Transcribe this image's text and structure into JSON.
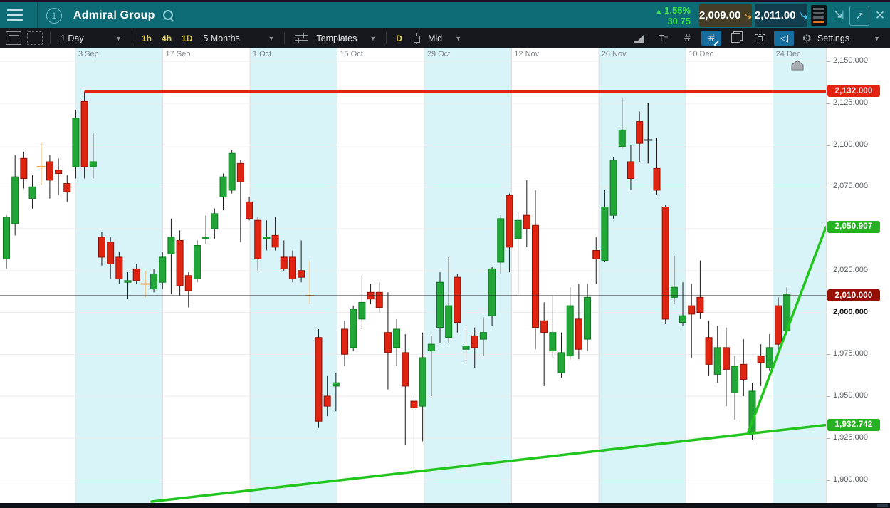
{
  "header": {
    "title": "Admiral Group",
    "change_percent": "1.55%",
    "change_up_symbol": "▲",
    "change_value": "30.75",
    "sell_price": "2,009.00",
    "buy_price": "2,011.00"
  },
  "toolbar": {
    "period_dropdown": "1 Day",
    "interval_buttons": [
      "1h",
      "4h",
      "1D"
    ],
    "range_dropdown": "5 Months",
    "templates_label": "Templates",
    "candle_period_button": "D",
    "price_type_dropdown": "Mid",
    "settings_label": "Settings"
  },
  "chart_data": {
    "type": "candlestick",
    "instrument": "Admiral Group",
    "interval": "1 Day",
    "range": "5 Months",
    "x_labels": [
      "3 Sep",
      "17 Sep",
      "1 Oct",
      "15 Oct",
      "29 Oct",
      "12 Nov",
      "26 Nov",
      "10 Dec",
      "24 Dec"
    ],
    "y_axis": {
      "min": 1900,
      "max": 2150,
      "grid_step": 25,
      "ticks": [
        {
          "label": "2,150.000",
          "price": 2150
        },
        {
          "label": "2,125.000",
          "price": 2125
        },
        {
          "label": "2,100.000",
          "price": 2100
        },
        {
          "label": "2,075.000",
          "price": 2075
        },
        {
          "label": "2,025.000",
          "price": 2025
        },
        {
          "label": "2,000.000",
          "price": 2000,
          "bold": true
        },
        {
          "label": "1,975.000",
          "price": 1975
        },
        {
          "label": "1,950.000",
          "price": 1950
        },
        {
          "label": "1,925.000",
          "price": 1925
        },
        {
          "label": "1,900.000",
          "price": 1900
        }
      ]
    },
    "price_tags": [
      {
        "label": "2,132.000",
        "price": 2132,
        "bg": "#e3230f",
        "role": "resistance-line-price"
      },
      {
        "label": "2,050.907",
        "price": 2050.907,
        "bg": "#25b220",
        "role": "rising-trendline-target"
      },
      {
        "label": "2,010.000",
        "price": 2010,
        "bg": "#970e02",
        "role": "current-price"
      },
      {
        "label": "1,932.742",
        "price": 1932.742,
        "bg": "#25b220",
        "role": "support-trendline-level"
      }
    ],
    "overlays": {
      "resistance_line": {
        "price": 2132,
        "color": "#e3230f"
      },
      "current_price_line": {
        "price": 2010,
        "color": "#222222"
      },
      "support_trendline": {
        "end_price": 1932.742,
        "color": "#22c51d"
      },
      "rising_trendline": {
        "end_price": 2050.907,
        "color": "#22c51d"
      }
    },
    "colors": {
      "up": "#21a637",
      "down": "#e02412",
      "doji_orange": "#f0a33c",
      "doji_dark": "#26282b",
      "band": "#d8f4f9"
    },
    "candles": [
      [
        2032,
        2058,
        2026,
        2057
      ],
      [
        2053,
        2094,
        2046,
        2081
      ],
      [
        2092,
        2096,
        2074,
        2080
      ],
      [
        2068,
        2082,
        2062,
        2075
      ],
      [
        2087,
        2101,
        2076,
        2087,
        "od"
      ],
      [
        2090,
        2094,
        2068,
        2079
      ],
      [
        2085,
        2092,
        2070,
        2083
      ],
      [
        2077,
        2082,
        2066,
        2072
      ],
      [
        2087,
        2121,
        2080,
        2116
      ],
      [
        2126,
        2132,
        2080,
        2087
      ],
      [
        2087,
        2107,
        2080,
        2090
      ],
      [
        2045,
        2048,
        2028,
        2033
      ],
      [
        2042,
        2045,
        2020,
        2029
      ],
      [
        2033,
        2036,
        2017,
        2020
      ],
      [
        2018,
        2024,
        2008,
        2019
      ],
      [
        2026,
        2029,
        2017,
        2019
      ],
      [
        2017,
        2025,
        2009,
        2017,
        "od"
      ],
      [
        2014,
        2026,
        2012,
        2023
      ],
      [
        2018,
        2036,
        2014,
        2033
      ],
      [
        2035,
        2056,
        2011,
        2045
      ],
      [
        2043,
        2049,
        2010,
        2016
      ],
      [
        2022,
        2024,
        2003,
        2013
      ],
      [
        2020,
        2043,
        2018,
        2040
      ],
      [
        2044,
        2058,
        2041,
        2045
      ],
      [
        2050,
        2062,
        2044,
        2059
      ],
      [
        2069,
        2083,
        2061,
        2081
      ],
      [
        2073,
        2097,
        2071,
        2095
      ],
      [
        2089,
        2091,
        2042,
        2078
      ],
      [
        2066,
        2069,
        2055,
        2056
      ],
      [
        2055,
        2057,
        2025,
        2032
      ],
      [
        2044,
        2055,
        2037,
        2045
      ],
      [
        2046,
        2057,
        2037,
        2039
      ],
      [
        2033,
        2043,
        2025,
        2026
      ],
      [
        2033,
        2037,
        2018,
        2020
      ],
      [
        2025,
        2043,
        2018,
        2021
      ],
      [
        2010,
        2031,
        2005,
        2010,
        "od"
      ],
      [
        1985,
        1990,
        1931,
        1935
      ],
      [
        1950,
        1962,
        1938,
        1944
      ],
      [
        1956,
        1964,
        1941,
        1958
      ],
      [
        1990,
        1995,
        1968,
        1975
      ],
      [
        1979,
        2004,
        1977,
        2002
      ],
      [
        1996,
        2022,
        1990,
        2006
      ],
      [
        2012,
        2017,
        2005,
        2008
      ],
      [
        2012,
        2018,
        2000,
        2003
      ],
      [
        1988,
        2012,
        1954,
        1976
      ],
      [
        1979,
        1996,
        1968,
        1990
      ],
      [
        1976,
        1987,
        1921,
        1956
      ],
      [
        1947,
        1951,
        1902,
        1943
      ],
      [
        1944,
        1988,
        1923,
        1973
      ],
      [
        1977,
        1986,
        1950,
        1981
      ],
      [
        1991,
        2024,
        1982,
        2018
      ],
      [
        1985,
        2033,
        1982,
        2004
      ],
      [
        2021,
        2023,
        1988,
        1994
      ],
      [
        1978,
        1992,
        1970,
        1980
      ],
      [
        1986,
        1991,
        1967,
        1979
      ],
      [
        1984,
        1997,
        1974,
        1988
      ],
      [
        1998,
        2027,
        1992,
        2026
      ],
      [
        2030,
        2058,
        2023,
        2056
      ],
      [
        2070,
        2071,
        2024,
        2039
      ],
      [
        2044,
        2060,
        2011,
        2055
      ],
      [
        2058,
        2079,
        2039,
        2050
      ],
      [
        2052,
        2073,
        1978,
        1991
      ],
      [
        1995,
        2006,
        1956,
        1988
      ],
      [
        1977,
        2010,
        1973,
        1988
      ],
      [
        1964,
        1988,
        1961,
        1976
      ],
      [
        1974,
        2015,
        1972,
        2004
      ],
      [
        1996,
        2017,
        1972,
        1978
      ],
      [
        1984,
        2017,
        1977,
        2009
      ],
      [
        2037,
        2045,
        2017,
        2032
      ],
      [
        2031,
        2073,
        2030,
        2063
      ],
      [
        2058,
        2093,
        2056,
        2091
      ],
      [
        2099,
        2128,
        2098,
        2109
      ],
      [
        2090,
        2100,
        2073,
        2080
      ],
      [
        2114,
        2120,
        2090,
        2101
      ],
      [
        2103,
        2125,
        2089,
        2103,
        "kd"
      ],
      [
        2086,
        2104,
        2070,
        2073
      ],
      [
        2063,
        2064,
        1993,
        1996
      ],
      [
        2009,
        2034,
        2005,
        2015
      ],
      [
        1994,
        2018,
        1992,
        1998
      ],
      [
        2004,
        2017,
        1973,
        1999
      ],
      [
        2009,
        2031,
        1996,
        2000
      ],
      [
        1985,
        1995,
        1962,
        1969
      ],
      [
        1963,
        1992,
        1958,
        1979
      ],
      [
        1979,
        1991,
        1944,
        1966
      ],
      [
        1952,
        1974,
        1936,
        1968
      ],
      [
        1969,
        1984,
        1950,
        1960
      ],
      [
        1928,
        1958,
        1924,
        1953
      ],
      [
        1974,
        1981,
        1956,
        1970
      ],
      [
        1967,
        1987,
        1965,
        1979
      ],
      [
        2004,
        2009,
        1978,
        1981
      ],
      [
        1989,
        2015,
        1988,
        2011
      ]
    ]
  }
}
